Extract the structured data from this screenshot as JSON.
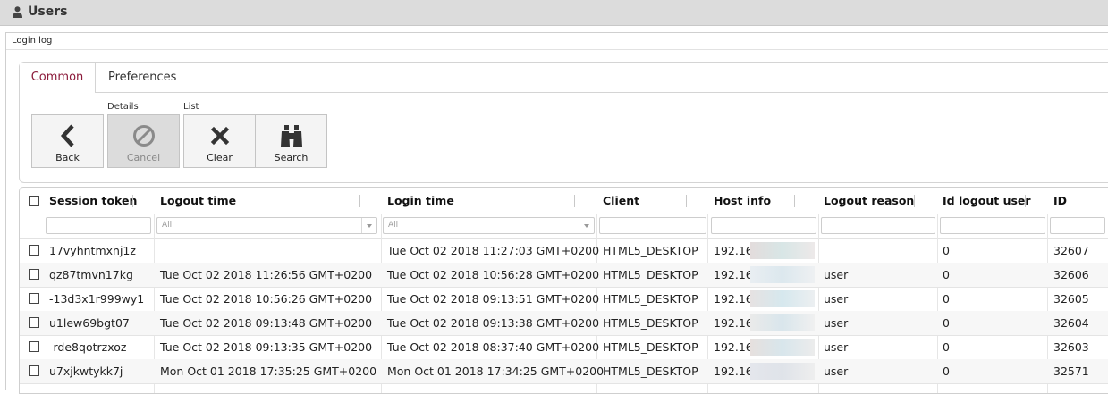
{
  "window": {
    "title": "Users",
    "icon": "user-icon"
  },
  "panel": {
    "title": "Login log"
  },
  "tabs": [
    {
      "label": "Common",
      "active": true
    },
    {
      "label": "Preferences",
      "active": false
    }
  ],
  "toolbar": {
    "groups": {
      "details": "Details",
      "list": "List"
    },
    "back": {
      "label": "Back",
      "icon": "chevron-left-icon"
    },
    "cancel": {
      "label": "Cancel",
      "icon": "ban-icon",
      "disabled": true
    },
    "clear": {
      "label": "Clear",
      "icon": "x-icon"
    },
    "search": {
      "label": "Search",
      "icon": "binoculars-icon"
    }
  },
  "grid": {
    "columns": [
      "Session token",
      "Logout time",
      "Login time",
      "Client",
      "Host info",
      "Logout reason",
      "Id logout user",
      "ID"
    ],
    "filters": {
      "logout_time": "All",
      "login_time": "All"
    },
    "rows": [
      {
        "token": "17vyhntmxnj1z",
        "logout": "",
        "login": "Tue Oct 02 2018 11:27:03 GMT+0200",
        "client": "HTML5_DESKTOP",
        "host": "192.168",
        "reason": "",
        "id_logout_user": "0",
        "id": "32607"
      },
      {
        "token": "qz87tmvn17kg",
        "logout": "Tue Oct 02 2018 11:26:56 GMT+0200",
        "login": "Tue Oct 02 2018 10:56:28 GMT+0200",
        "client": "HTML5_DESKTOP",
        "host": "192.168",
        "reason": "user",
        "id_logout_user": "0",
        "id": "32606"
      },
      {
        "token": "-13d3x1r999wy1",
        "logout": "Tue Oct 02 2018 10:56:26 GMT+0200",
        "login": "Tue Oct 02 2018 09:13:51 GMT+0200",
        "client": "HTML5_DESKTOP",
        "host": "192.168",
        "reason": "user",
        "id_logout_user": "0",
        "id": "32605"
      },
      {
        "token": "u1lew69bgt07",
        "logout": "Tue Oct 02 2018 09:13:48 GMT+0200",
        "login": "Tue Oct 02 2018 09:13:38 GMT+0200",
        "client": "HTML5_DESKTOP",
        "host": "192.168",
        "reason": "user",
        "id_logout_user": "0",
        "id": "32604"
      },
      {
        "token": "-rde8qotrzxoz",
        "logout": "Tue Oct 02 2018 09:13:35 GMT+0200",
        "login": "Tue Oct 02 2018 08:37:40 GMT+0200",
        "client": "HTML5_DESKTOP",
        "host": "192.168",
        "reason": "user",
        "id_logout_user": "0",
        "id": "32603"
      },
      {
        "token": "u7xjkwtykk7j",
        "logout": "Mon Oct 01 2018 17:35:25 GMT+0200",
        "login": "Mon Oct 01 2018 17:34:25 GMT+0200",
        "client": "HTML5_DESKTOP",
        "host": "192.168",
        "reason": "user",
        "id_logout_user": "0",
        "id": "32571"
      }
    ]
  },
  "colors": {
    "accent": "#8b1a3a",
    "titlebar": "#dcdcdc",
    "button": "#f4f4f4",
    "button_disabled": "#dcdcdc"
  }
}
